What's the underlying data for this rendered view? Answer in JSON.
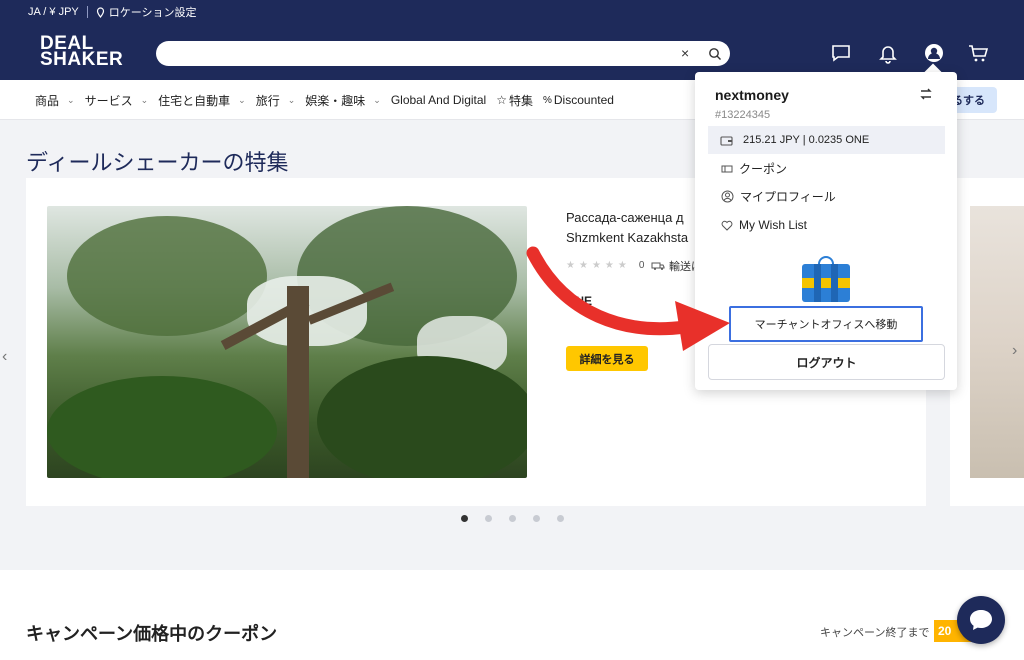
{
  "topbar": {
    "locale": "JA / ¥ JPY",
    "location": "ロケーション設定"
  },
  "header": {
    "logo_line1": "DEAL",
    "logo_line2": "SHAKER",
    "search": {
      "value": "",
      "placeholder": ""
    },
    "icons": [
      "chat-icon",
      "bell-icon",
      "user-icon",
      "cart-icon"
    ]
  },
  "categories": {
    "items": [
      {
        "label": "商品",
        "has_chevron": true
      },
      {
        "label": "サービス",
        "has_chevron": true
      },
      {
        "label": "住宅と自動車",
        "has_chevron": true
      },
      {
        "label": "旅行",
        "has_chevron": true
      },
      {
        "label": "娯楽・趣味",
        "has_chevron": true
      },
      {
        "label": "Global And Digital",
        "has_chevron": false
      },
      {
        "label": "特集",
        "has_chevron": false
      },
      {
        "label": "Discounted",
        "has_chevron": false
      }
    ],
    "right_button_partial": "るする"
  },
  "featured": {
    "title": "ディールシェーカーの特集",
    "card": {
      "title_line1": "Рассада-саженца д",
      "title_line2": "Shzmkent Kazakhsta",
      "rating_count": "0",
      "shipping": "輸送は",
      "price": "ONE",
      "detail_button": "詳細を見る"
    }
  },
  "campaign": {
    "title": "キャンペーン価格中のクーポン",
    "ends_label": "キャンペーン終了まで",
    "timer": "20"
  },
  "dropdown": {
    "username": "nextmoney",
    "user_id": "#13224345",
    "wallet": "215.21 JPY | 0.0235 ONE",
    "coupon": "クーポン",
    "profile": "マイプロフィール",
    "wishlist": "My Wish List",
    "merchant_office": "マーチャントオフィスへ移動",
    "logout": "ログアウト"
  },
  "colors": {
    "navy": "#1e2a5a",
    "yellow": "#ffc700",
    "annotation_red": "#e8302a",
    "highlight_blue": "#3b6fe0"
  }
}
